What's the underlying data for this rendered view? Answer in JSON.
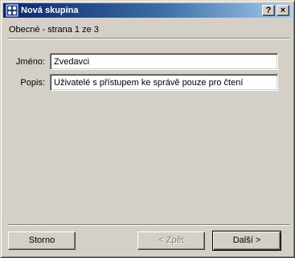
{
  "window": {
    "title": "Nová skupina",
    "help_button": "?",
    "close_button": "×"
  },
  "page": {
    "label": "Obecné - strana 1 ze 3"
  },
  "form": {
    "name_label": "Jméno:",
    "name_value": "Zvedavci",
    "description_label": "Popis:",
    "description_value": "Uživatelé s přístupem ke správě pouze pro čtení"
  },
  "buttons": {
    "cancel": "Storno",
    "back": "< Zpět",
    "next": "Další >"
  },
  "icons": {
    "title_icon": "group-icon"
  }
}
